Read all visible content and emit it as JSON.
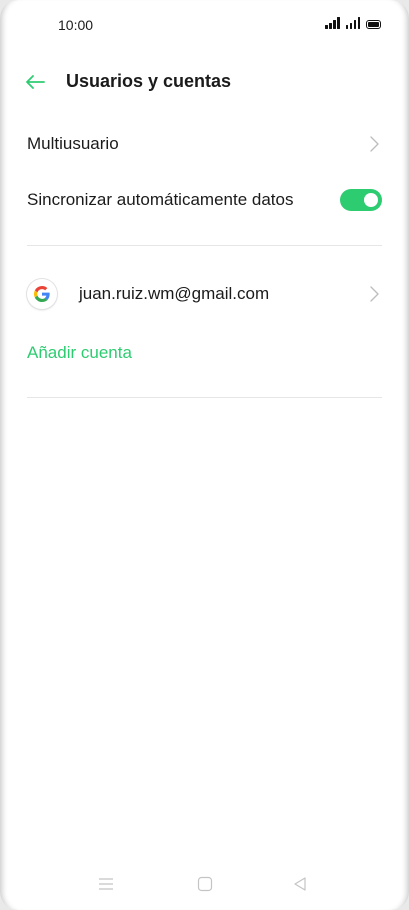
{
  "status_bar": {
    "time": "10:00"
  },
  "header": {
    "title": "Usuarios y cuentas"
  },
  "settings": {
    "multiuser_label": "Multiusuario",
    "auto_sync_label": "Sincronizar automáticamente datos",
    "auto_sync_on": true
  },
  "accounts": {
    "items": [
      {
        "email": "juan.ruiz.wm@gmail.com",
        "provider_icon": "google-icon"
      }
    ],
    "add_label": "Añadir cuenta"
  },
  "colors": {
    "accent": "#2ECC71",
    "text": "#1B1B1B",
    "chevron": "#BDBDBD"
  },
  "nav_bar": {
    "buttons": [
      "menu-icon",
      "home-icon",
      "back-icon"
    ]
  }
}
